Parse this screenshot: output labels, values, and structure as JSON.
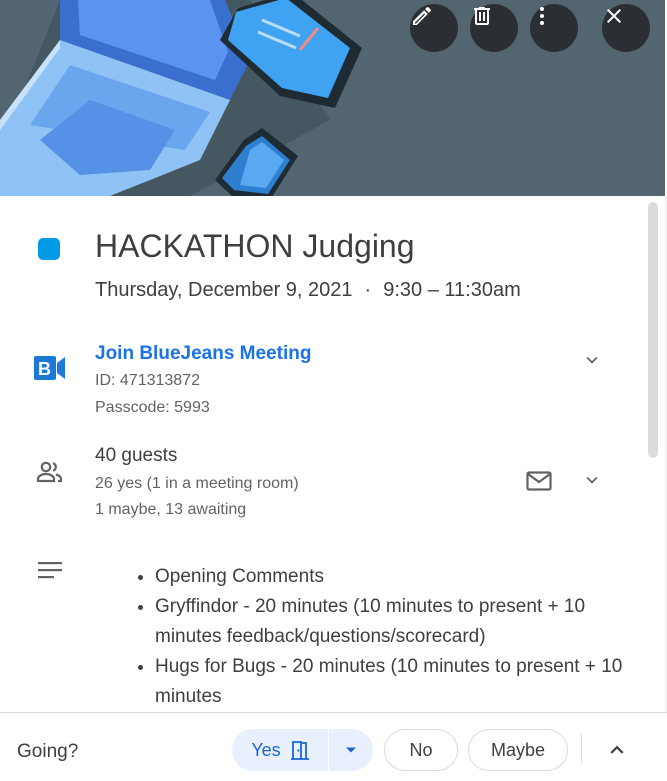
{
  "header": {
    "edit_icon": "pencil-icon",
    "delete_icon": "trash-icon",
    "more_icon": "more-vert-icon",
    "close_icon": "close-icon"
  },
  "event": {
    "color": "#039be5",
    "title": "HACKATHON Judging",
    "date": "Thursday, December 9, 2021",
    "separator": "·",
    "time": "9:30 – 11:30am"
  },
  "meeting": {
    "logo_text": "B",
    "join_label": "Join BlueJeans Meeting",
    "id_line": "ID: 471313872",
    "passcode_line": "Passcode: 5993"
  },
  "guests": {
    "count_label": "40 guests",
    "yes_line": "26 yes (1 in a meeting room)",
    "other_line": "1 maybe, 13 awaiting"
  },
  "description": {
    "items": [
      "Opening Comments",
      "Gryffindor - 20 minutes (10 minutes to present + 10 minutes feedback/questions/scorecard)",
      "Hugs for Bugs - 20 minutes (10 minutes to present + 10 minutes"
    ]
  },
  "footer": {
    "going_label": "Going?",
    "yes_label": "Yes",
    "no_label": "No",
    "maybe_label": "Maybe"
  },
  "colors": {
    "accent": "#1a73e8",
    "yes_bg": "#e8f0fe",
    "banner": "#536570"
  }
}
